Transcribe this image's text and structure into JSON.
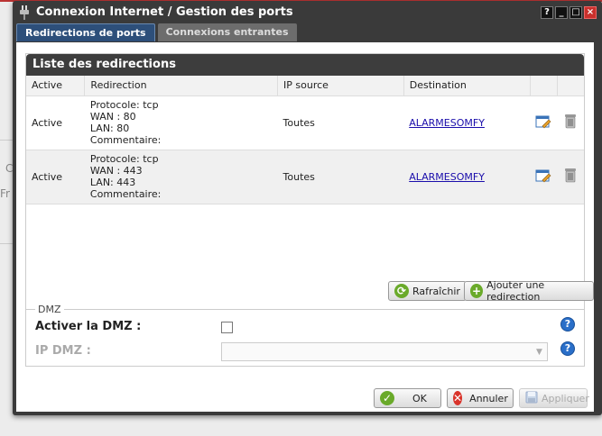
{
  "window": {
    "title": "Connexion Internet / Gestion des ports",
    "controls": [
      "?",
      "_",
      "□",
      "×"
    ]
  },
  "tabs": [
    {
      "label": "Redirections de ports",
      "active": true
    },
    {
      "label": "Connexions entrantes",
      "active": false
    }
  ],
  "redirections": {
    "header": "Liste des redirections",
    "columns": [
      "Active",
      "Redirection",
      "IP source",
      "Destination",
      "",
      ""
    ],
    "rows": [
      {
        "active": "Active",
        "protocol": "Protocole: tcp",
        "wan": "WAN : 80",
        "lan": "LAN: 80",
        "comment": "Commentaire:",
        "ip_source": "Toutes",
        "destination": "ALARMESOMFY"
      },
      {
        "active": "Active",
        "protocol": "Protocole: tcp",
        "wan": "WAN : 443",
        "lan": "LAN: 443",
        "comment": "Commentaire:",
        "ip_source": "Toutes",
        "destination": "ALARMESOMFY"
      }
    ],
    "refresh_label": "Rafraîchir",
    "add_label": "Ajouter une redirection"
  },
  "dmz": {
    "legend": "DMZ",
    "enable_label": "Activer la DMZ :",
    "enabled": false,
    "ip_label": "IP DMZ :",
    "ip_value": ""
  },
  "footer": {
    "ok_label": "OK",
    "cancel_label": "Annuler",
    "apply_label": "Appliquer"
  },
  "colors": {
    "tab_active": "#2d4f7a",
    "window_frame": "#3a3a3a",
    "ok_icon": "#6aaa2a",
    "cancel_icon": "#d9342b",
    "help_icon": "#2a6fc9"
  }
}
